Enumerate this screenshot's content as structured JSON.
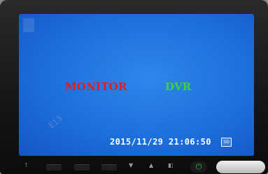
{
  "screen": {
    "labels": {
      "monitor": "MONITOR",
      "dvr": "DVR"
    },
    "stamp_text": "E13",
    "datetime": "2015/11/29 21:06:50",
    "sd_icon": "sd-card-icon",
    "colors": {
      "background": "#1d6fdc",
      "monitor": "#e01e1e",
      "dvr": "#3ed33a",
      "datetime": "#ffffff"
    }
  },
  "controls": {
    "icons": [
      "up-arrow-icon",
      "left-button",
      "menu-button",
      "right-button",
      "down-arrow-icon",
      "up-arrow-icon",
      "dual-screen-icon",
      "power-icon"
    ],
    "power_color": "#45b045"
  }
}
